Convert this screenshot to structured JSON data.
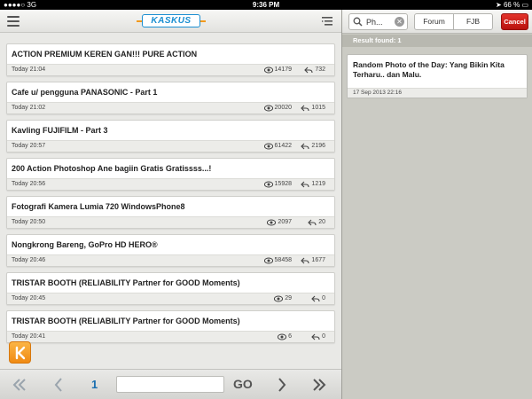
{
  "status_bar": {
    "carrier": "3G",
    "time": "9:36 PM",
    "battery": "66 %"
  },
  "header": {
    "logo": "KASKUS"
  },
  "threads": [
    {
      "title": "ACTION PREMIUM KEREN GAN!!! PURE ACTION",
      "time": "Today 21:04",
      "views": "14179",
      "replies": "732"
    },
    {
      "title": "Cafe u/ pengguna PANASONIC - Part 1",
      "time": "Today 21:02",
      "views": "20020",
      "replies": "1015"
    },
    {
      "title": "Kavling FUJIFILM  - Part 3",
      "time": "Today 20:57",
      "views": "61422",
      "replies": "2196"
    },
    {
      "title": "200 Action Photoshop Ane bagiin Gratis Gratissss...!",
      "time": "Today 20:56",
      "views": "15928",
      "replies": "1219"
    },
    {
      "title": "Fotografi Kamera Lumia 720 WindowsPhone8",
      "time": "Today 20:50",
      "views": "2097",
      "replies": "20"
    },
    {
      "title": "Nongkrong Bareng, GoPro HD HERO®",
      "time": "Today 20:46",
      "views": "58458",
      "replies": "1677"
    },
    {
      "title": "TRISTAR BOOTH (RELIABILITY Partner for GOOD Moments)",
      "time": "Today 20:45",
      "views": "29",
      "replies": "0"
    },
    {
      "title": "TRISTAR BOOTH (RELIABILITY Partner for GOOD Moments)",
      "time": "Today 20:41",
      "views": "6",
      "replies": "0"
    }
  ],
  "pager": {
    "page": "1",
    "go_label": "GO",
    "input_value": ""
  },
  "search": {
    "query": "Ph...",
    "tabs": [
      "Forum",
      "FJB"
    ],
    "cancel_label": "Cancel",
    "result_count": "Result found: 1",
    "results": [
      {
        "title": "Random Photo of the Day: Yang Bikin Kita Terharu.. dan Malu.",
        "date": "17 Sep 2013 22:16"
      }
    ]
  },
  "colors": {
    "accent_blue": "#1b8fd1",
    "kaskus_orange": "#f08a12",
    "cancel_red": "#c41a15"
  }
}
